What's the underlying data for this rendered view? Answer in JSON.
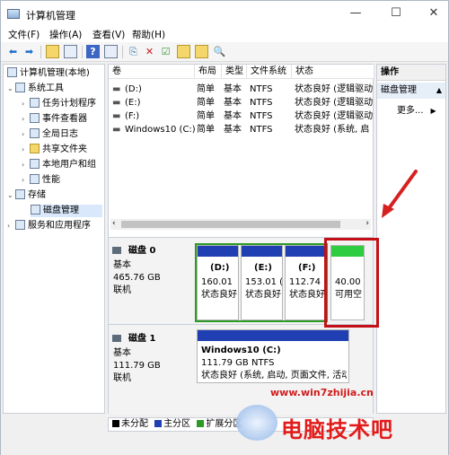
{
  "window": {
    "title": "计算机管理",
    "controls": {
      "minimize": "—",
      "maximize": "☐",
      "close": "✕"
    }
  },
  "menu": [
    "文件(F)",
    "操作(A)",
    "查看(V)",
    "帮助(H)"
  ],
  "toolbar_icons": [
    "back-icon",
    "forward-icon",
    "up-folder-icon",
    "properties-icon",
    "help-icon",
    "view-icon",
    "connect-icon",
    "delete-icon",
    "check-icon",
    "new-icon",
    "edit-icon",
    "search-icon"
  ],
  "tree": {
    "root": "计算机管理(本地)",
    "system_tools": "系统工具",
    "items": [
      "任务计划程序",
      "事件查看器",
      "全局日志",
      "共享文件夹",
      "本地用户和组",
      "性能"
    ],
    "storage": "存储",
    "disk_mgmt": "磁盘管理",
    "services": "服务和应用程序"
  },
  "columns": [
    "卷",
    "布局",
    "类型",
    "文件系统",
    "状态"
  ],
  "volumes": [
    {
      "name": "(D:)",
      "layout": "简单",
      "type": "基本",
      "fs": "NTFS",
      "status": "状态良好 (逻辑驱动"
    },
    {
      "name": "(E:)",
      "layout": "简单",
      "type": "基本",
      "fs": "NTFS",
      "status": "状态良好 (逻辑驱动"
    },
    {
      "name": "(F:)",
      "layout": "简单",
      "type": "基本",
      "fs": "NTFS",
      "status": "状态良好 (逻辑驱动"
    },
    {
      "name": "Windows10 (C:)",
      "layout": "简单",
      "type": "基本",
      "fs": "NTFS",
      "status": "状态良好 (系统, 启"
    }
  ],
  "disk0": {
    "name": "磁盘 0",
    "kind": "基本",
    "size": "465.76 GB",
    "state": "联机",
    "partitions": [
      {
        "label": "(D:)",
        "size": "160.01",
        "status": "状态良好"
      },
      {
        "label": "(E:)",
        "size": "153.01 (",
        "status": "状态良好"
      },
      {
        "label": "(F:)",
        "size": "112.74",
        "status": "状态良好"
      },
      {
        "label": "",
        "size": "40.00",
        "status": "可用空"
      }
    ]
  },
  "disk1": {
    "name": "磁盘 1",
    "kind": "基本",
    "size": "111.79 GB",
    "state": "联机",
    "partition": {
      "label": "Windows10  (C:)",
      "size": "111.79 GB NTFS",
      "status": "状态良好 (系统, 启动, 页面文件, 活动"
    }
  },
  "legend": [
    {
      "label": "未分配",
      "color": "#000000"
    },
    {
      "label": "主分区",
      "color": "#1f3fb3"
    },
    {
      "label": "扩展分区",
      "color": "#2d9a27"
    }
  ],
  "actions": {
    "header": "操作",
    "sub": "磁盘管理",
    "more": "更多..."
  },
  "colors": {
    "primary": "#1f3fb3",
    "logical": "#1f3fb3",
    "free": "#2ecc40",
    "highlight": "#c40f16"
  },
  "watermark": {
    "url": "www.win7zhijia.cn",
    "brand": "电脑技术吧"
  }
}
